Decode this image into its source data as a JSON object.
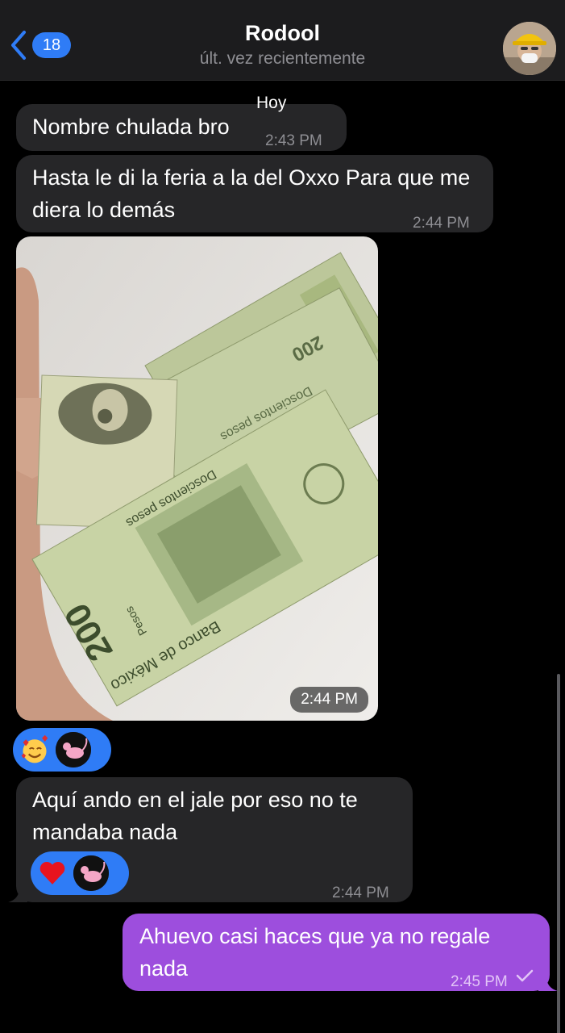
{
  "header": {
    "back_count": "18",
    "contact_name": "Rodool",
    "status": "últ. vez recientemente"
  },
  "chat": {
    "day_label": "Hoy",
    "messages": [
      {
        "direction": "in",
        "text": "Nombre chulada bro",
        "time": "2:43 PM"
      },
      {
        "direction": "in",
        "text": "Hasta le di la feria a la del Oxxo Para que me diera lo demás",
        "time": "2:44 PM"
      },
      {
        "direction": "in",
        "type": "photo",
        "time": "2:44 PM",
        "reactions": [
          "smiling-face-with-hearts",
          "pink-panther-avatar"
        ]
      },
      {
        "direction": "in",
        "text": "Aquí ando en el jale por eso no te mandaba nada",
        "time": "2:44 PM",
        "reactions": [
          "red-heart",
          "pink-panther-avatar"
        ]
      },
      {
        "direction": "out",
        "text": "Ahuevo casi haces que ya no regale nada",
        "time": "2:45 PM",
        "status": "sent"
      }
    ],
    "photo_text": {
      "banknote_value": "200",
      "banknote_word": "Pesos",
      "bank_name": "Banco de México",
      "denomination_text": "Doscientos pesos"
    }
  },
  "colors": {
    "incoming_bubble": "#262628",
    "outgoing_bubble": "#9d4edd",
    "accent_blue": "#2f7cf6",
    "background": "#000000"
  }
}
